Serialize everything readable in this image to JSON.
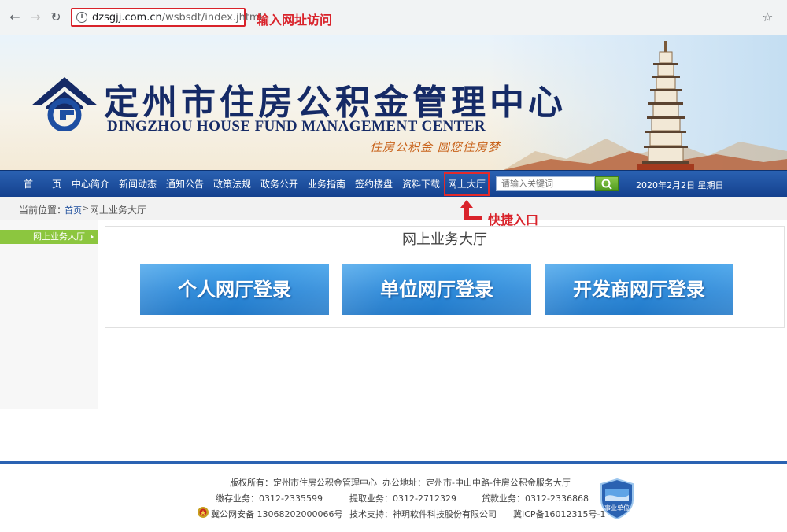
{
  "browser": {
    "url_host": "dzsgjj.com.cn",
    "url_path": "/wsbsdt/index.jhtml",
    "annotation": "输入网址访问"
  },
  "banner": {
    "title": "定州市住房公积金管理中心",
    "subtitle": "DINGZHOU HOUSE FUND MANAGEMENT CENTER",
    "slogan": "住房公积金   圆您住房梦"
  },
  "nav": {
    "items": [
      "首　　页",
      "中心简介",
      "新闻动态",
      "通知公告",
      "政策法规",
      "政务公开",
      "业务指南",
      "签约楼盘",
      "资料下载",
      "网上大厅"
    ],
    "search_placeholder": "请输入关键词",
    "date": "2020年2月2日  星期日"
  },
  "breadcrumb": {
    "label": "当前位置：",
    "home": "首页",
    "separator": ">",
    "current": "网上业务大厅"
  },
  "annotation_entry": "快捷入口",
  "sidebar": {
    "item": "网上业务大厅"
  },
  "main": {
    "title": "网上业务大厅",
    "buttons": [
      "个人网厅登录",
      "单位网厅登录",
      "开发商网厅登录"
    ]
  },
  "footer": {
    "copyright": "版权所有：定州市住房公积金管理中心",
    "address": "办公地址：定州市-中山中路-住房公积金服务大厅",
    "deposit": "缴存业务：0312-2335599",
    "withdraw": "提取业务：0312-2712329",
    "loan": "贷款业务：0312-2336868",
    "police": "冀公网安备 13068202000066号",
    "support": "技术支持：神玥软件科技股份有限公司",
    "icp": "冀ICP备16012315号-1",
    "badge_text": "事业单位"
  },
  "colors": {
    "nav_bg": "#14418e",
    "annotation_red": "#d9232b",
    "title_blue": "#152a66",
    "button_blue": "#2b88d8",
    "sidebar_green": "#8cc63f"
  }
}
